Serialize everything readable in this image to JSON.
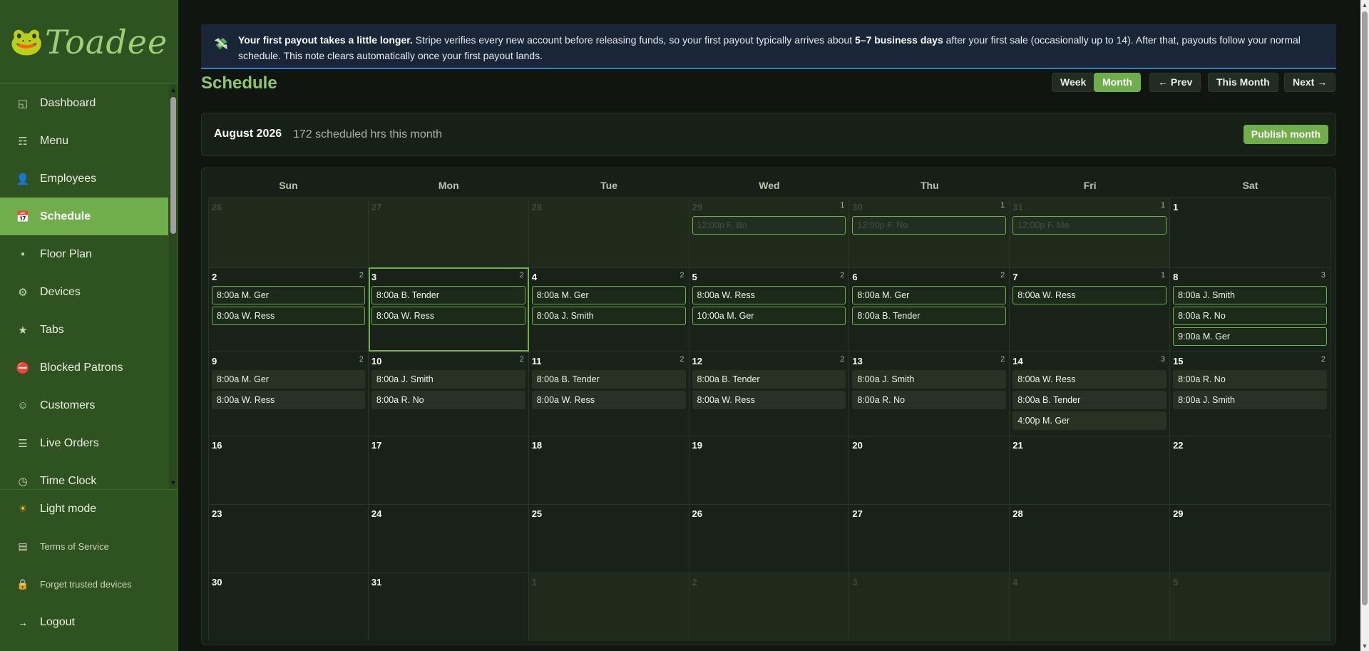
{
  "brand": "Toadee",
  "nav": [
    {
      "label": "Dashboard",
      "icon": "dashboard-icon",
      "glyph": "◱"
    },
    {
      "label": "Menu",
      "icon": "menu-icon",
      "glyph": "☶"
    },
    {
      "label": "Employees",
      "icon": "employees-icon",
      "glyph": "👤"
    },
    {
      "label": "Schedule",
      "icon": "calendar-icon",
      "glyph": "📅"
    },
    {
      "label": "Floor Plan",
      "icon": "floor-plan-icon",
      "glyph": "▪"
    },
    {
      "label": "Devices",
      "icon": "gear-icon",
      "glyph": "⚙"
    },
    {
      "label": "Tabs",
      "icon": "star-icon",
      "glyph": "★"
    },
    {
      "label": "Blocked Patrons",
      "icon": "blocked-icon",
      "glyph": "⛔"
    },
    {
      "label": "Customers",
      "icon": "customers-icon",
      "glyph": "☺"
    },
    {
      "label": "Live Orders",
      "icon": "list-icon",
      "glyph": "☰"
    },
    {
      "label": "Time Clock",
      "icon": "clock-icon",
      "glyph": "◷"
    }
  ],
  "footer": {
    "light_mode": "Light mode",
    "terms": "Terms of Service",
    "forget": "Forget trusted devices",
    "logout": "Logout"
  },
  "banner": {
    "bold": "Your first payout takes a little longer.",
    "text1": " Stripe verifies every new account before releasing funds, so your first payout typically arrives about ",
    "days": "5–7 business days",
    "text2": " after your first sale (occasionally up to 14). After that, payouts follow your normal schedule. This note clears automatically once your first payout lands."
  },
  "page_title": "Schedule",
  "toolbar": {
    "week": "Week",
    "month": "Month",
    "prev": "← Prev",
    "this_month": "This Month",
    "next": "Next →"
  },
  "month": {
    "name": "August 2026",
    "hours": "172 scheduled hrs this month",
    "publish": "Publish month"
  },
  "weekdays": [
    "Sun",
    "Mon",
    "Tue",
    "Wed",
    "Thu",
    "Fri",
    "Sat"
  ],
  "weeks": [
    [
      {
        "day": "26",
        "other": true,
        "count": "",
        "shifts": []
      },
      {
        "day": "27",
        "other": true,
        "count": "",
        "shifts": []
      },
      {
        "day": "28",
        "other": true,
        "count": "",
        "shifts": []
      },
      {
        "day": "29",
        "other": true,
        "count": "1",
        "shifts": [
          {
            "t": "12:00p F. Bo",
            "dim": true
          }
        ]
      },
      {
        "day": "30",
        "other": true,
        "count": "1",
        "shifts": [
          {
            "t": "12:00p F. No",
            "dim": true
          }
        ]
      },
      {
        "day": "31",
        "other": true,
        "count": "1",
        "shifts": [
          {
            "t": "12:00p F. Me",
            "dim": true
          }
        ]
      },
      {
        "day": "1",
        "other": false,
        "count": "",
        "shifts": []
      }
    ],
    [
      {
        "day": "2",
        "count": "2",
        "shifts": [
          {
            "t": "8:00a M. Ger"
          },
          {
            "t": "8:00a W. Ress"
          }
        ]
      },
      {
        "day": "3",
        "count": "2",
        "today": true,
        "shifts": [
          {
            "t": "8:00a B. Tender"
          },
          {
            "t": "8:00a W. Ress"
          }
        ]
      },
      {
        "day": "4",
        "count": "2",
        "shifts": [
          {
            "t": "8:00a M. Ger"
          },
          {
            "t": "8:00a J. Smith"
          }
        ]
      },
      {
        "day": "5",
        "count": "2",
        "shifts": [
          {
            "t": "8:00a W. Ress"
          },
          {
            "t": "10:00a M. Ger"
          }
        ]
      },
      {
        "day": "6",
        "count": "2",
        "shifts": [
          {
            "t": "8:00a M. Ger"
          },
          {
            "t": "8:00a B. Tender"
          }
        ]
      },
      {
        "day": "7",
        "count": "1",
        "shifts": [
          {
            "t": "8:00a W. Ress"
          }
        ]
      },
      {
        "day": "8",
        "count": "3",
        "shifts": [
          {
            "t": "8:00a J. Smith"
          },
          {
            "t": "8:00a R. No"
          },
          {
            "t": "9:00a M. Ger"
          }
        ]
      }
    ],
    [
      {
        "day": "9",
        "count": "2",
        "shifts": [
          {
            "t": "8:00a M. Ger",
            "pub": true
          },
          {
            "t": "8:00a W. Ress",
            "pub": true
          }
        ]
      },
      {
        "day": "10",
        "count": "2",
        "shifts": [
          {
            "t": "8:00a J. Smith",
            "pub": true
          },
          {
            "t": "8:00a R. No",
            "pub": true
          }
        ]
      },
      {
        "day": "11",
        "count": "2",
        "shifts": [
          {
            "t": "8:00a B. Tender",
            "pub": true
          },
          {
            "t": "8:00a W. Ress",
            "pub": true
          }
        ]
      },
      {
        "day": "12",
        "count": "2",
        "shifts": [
          {
            "t": "8:00a B. Tender",
            "pub": true
          },
          {
            "t": "8:00a W. Ress",
            "pub": true
          }
        ]
      },
      {
        "day": "13",
        "count": "2",
        "shifts": [
          {
            "t": "8:00a J. Smith",
            "pub": true
          },
          {
            "t": "8:00a R. No",
            "pub": true
          }
        ]
      },
      {
        "day": "14",
        "count": "3",
        "shifts": [
          {
            "t": "8:00a W. Ress",
            "pub": true
          },
          {
            "t": "8:00a B. Tender",
            "pub": true
          },
          {
            "t": "4:00p M. Ger",
            "pub": true
          }
        ]
      },
      {
        "day": "15",
        "count": "2",
        "shifts": [
          {
            "t": "8:00a R. No",
            "pub": true
          },
          {
            "t": "8:00a J. Smith",
            "pub": true
          }
        ]
      }
    ],
    [
      {
        "day": "16",
        "count": "",
        "shifts": []
      },
      {
        "day": "17",
        "count": "",
        "shifts": []
      },
      {
        "day": "18",
        "count": "",
        "shifts": []
      },
      {
        "day": "19",
        "count": "",
        "shifts": []
      },
      {
        "day": "20",
        "count": "",
        "shifts": []
      },
      {
        "day": "21",
        "count": "",
        "shifts": []
      },
      {
        "day": "22",
        "count": "",
        "shifts": []
      }
    ],
    [
      {
        "day": "23",
        "count": "",
        "shifts": []
      },
      {
        "day": "24",
        "count": "",
        "shifts": []
      },
      {
        "day": "25",
        "count": "",
        "shifts": []
      },
      {
        "day": "26",
        "count": "",
        "shifts": []
      },
      {
        "day": "27",
        "count": "",
        "shifts": []
      },
      {
        "day": "28",
        "count": "",
        "shifts": []
      },
      {
        "day": "29",
        "count": "",
        "shifts": []
      }
    ],
    [
      {
        "day": "30",
        "count": "",
        "shifts": []
      },
      {
        "day": "31",
        "count": "",
        "shifts": []
      },
      {
        "day": "1",
        "other": true,
        "count": "",
        "shifts": []
      },
      {
        "day": "2",
        "other": true,
        "count": "",
        "shifts": []
      },
      {
        "day": "3",
        "other": true,
        "count": "",
        "shifts": []
      },
      {
        "day": "4",
        "other": true,
        "count": "",
        "shifts": []
      },
      {
        "day": "5",
        "other": true,
        "count": "",
        "shifts": []
      }
    ]
  ]
}
